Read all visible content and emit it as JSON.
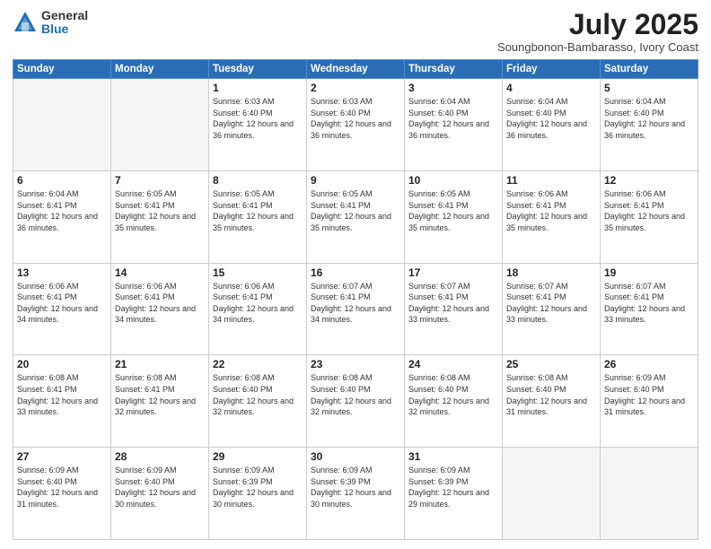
{
  "header": {
    "logo_general": "General",
    "logo_blue": "Blue",
    "title": "July 2025",
    "location": "Soungbonon-Bambarasso, Ivory Coast"
  },
  "days_of_week": [
    "Sunday",
    "Monday",
    "Tuesday",
    "Wednesday",
    "Thursday",
    "Friday",
    "Saturday"
  ],
  "weeks": [
    [
      {
        "day": "",
        "info": ""
      },
      {
        "day": "",
        "info": ""
      },
      {
        "day": "1",
        "info": "Sunrise: 6:03 AM\nSunset: 6:40 PM\nDaylight: 12 hours and 36 minutes."
      },
      {
        "day": "2",
        "info": "Sunrise: 6:03 AM\nSunset: 6:40 PM\nDaylight: 12 hours and 36 minutes."
      },
      {
        "day": "3",
        "info": "Sunrise: 6:04 AM\nSunset: 6:40 PM\nDaylight: 12 hours and 36 minutes."
      },
      {
        "day": "4",
        "info": "Sunrise: 6:04 AM\nSunset: 6:40 PM\nDaylight: 12 hours and 36 minutes."
      },
      {
        "day": "5",
        "info": "Sunrise: 6:04 AM\nSunset: 6:40 PM\nDaylight: 12 hours and 36 minutes."
      }
    ],
    [
      {
        "day": "6",
        "info": "Sunrise: 6:04 AM\nSunset: 6:41 PM\nDaylight: 12 hours and 36 minutes."
      },
      {
        "day": "7",
        "info": "Sunrise: 6:05 AM\nSunset: 6:41 PM\nDaylight: 12 hours and 35 minutes."
      },
      {
        "day": "8",
        "info": "Sunrise: 6:05 AM\nSunset: 6:41 PM\nDaylight: 12 hours and 35 minutes."
      },
      {
        "day": "9",
        "info": "Sunrise: 6:05 AM\nSunset: 6:41 PM\nDaylight: 12 hours and 35 minutes."
      },
      {
        "day": "10",
        "info": "Sunrise: 6:05 AM\nSunset: 6:41 PM\nDaylight: 12 hours and 35 minutes."
      },
      {
        "day": "11",
        "info": "Sunrise: 6:06 AM\nSunset: 6:41 PM\nDaylight: 12 hours and 35 minutes."
      },
      {
        "day": "12",
        "info": "Sunrise: 6:06 AM\nSunset: 6:41 PM\nDaylight: 12 hours and 35 minutes."
      }
    ],
    [
      {
        "day": "13",
        "info": "Sunrise: 6:06 AM\nSunset: 6:41 PM\nDaylight: 12 hours and 34 minutes."
      },
      {
        "day": "14",
        "info": "Sunrise: 6:06 AM\nSunset: 6:41 PM\nDaylight: 12 hours and 34 minutes."
      },
      {
        "day": "15",
        "info": "Sunrise: 6:06 AM\nSunset: 6:41 PM\nDaylight: 12 hours and 34 minutes."
      },
      {
        "day": "16",
        "info": "Sunrise: 6:07 AM\nSunset: 6:41 PM\nDaylight: 12 hours and 34 minutes."
      },
      {
        "day": "17",
        "info": "Sunrise: 6:07 AM\nSunset: 6:41 PM\nDaylight: 12 hours and 33 minutes."
      },
      {
        "day": "18",
        "info": "Sunrise: 6:07 AM\nSunset: 6:41 PM\nDaylight: 12 hours and 33 minutes."
      },
      {
        "day": "19",
        "info": "Sunrise: 6:07 AM\nSunset: 6:41 PM\nDaylight: 12 hours and 33 minutes."
      }
    ],
    [
      {
        "day": "20",
        "info": "Sunrise: 6:08 AM\nSunset: 6:41 PM\nDaylight: 12 hours and 33 minutes."
      },
      {
        "day": "21",
        "info": "Sunrise: 6:08 AM\nSunset: 6:41 PM\nDaylight: 12 hours and 32 minutes."
      },
      {
        "day": "22",
        "info": "Sunrise: 6:08 AM\nSunset: 6:40 PM\nDaylight: 12 hours and 32 minutes."
      },
      {
        "day": "23",
        "info": "Sunrise: 6:08 AM\nSunset: 6:40 PM\nDaylight: 12 hours and 32 minutes."
      },
      {
        "day": "24",
        "info": "Sunrise: 6:08 AM\nSunset: 6:40 PM\nDaylight: 12 hours and 32 minutes."
      },
      {
        "day": "25",
        "info": "Sunrise: 6:08 AM\nSunset: 6:40 PM\nDaylight: 12 hours and 31 minutes."
      },
      {
        "day": "26",
        "info": "Sunrise: 6:09 AM\nSunset: 6:40 PM\nDaylight: 12 hours and 31 minutes."
      }
    ],
    [
      {
        "day": "27",
        "info": "Sunrise: 6:09 AM\nSunset: 6:40 PM\nDaylight: 12 hours and 31 minutes."
      },
      {
        "day": "28",
        "info": "Sunrise: 6:09 AM\nSunset: 6:40 PM\nDaylight: 12 hours and 30 minutes."
      },
      {
        "day": "29",
        "info": "Sunrise: 6:09 AM\nSunset: 6:39 PM\nDaylight: 12 hours and 30 minutes."
      },
      {
        "day": "30",
        "info": "Sunrise: 6:09 AM\nSunset: 6:39 PM\nDaylight: 12 hours and 30 minutes."
      },
      {
        "day": "31",
        "info": "Sunrise: 6:09 AM\nSunset: 6:39 PM\nDaylight: 12 hours and 29 minutes."
      },
      {
        "day": "",
        "info": ""
      },
      {
        "day": "",
        "info": ""
      }
    ]
  ]
}
